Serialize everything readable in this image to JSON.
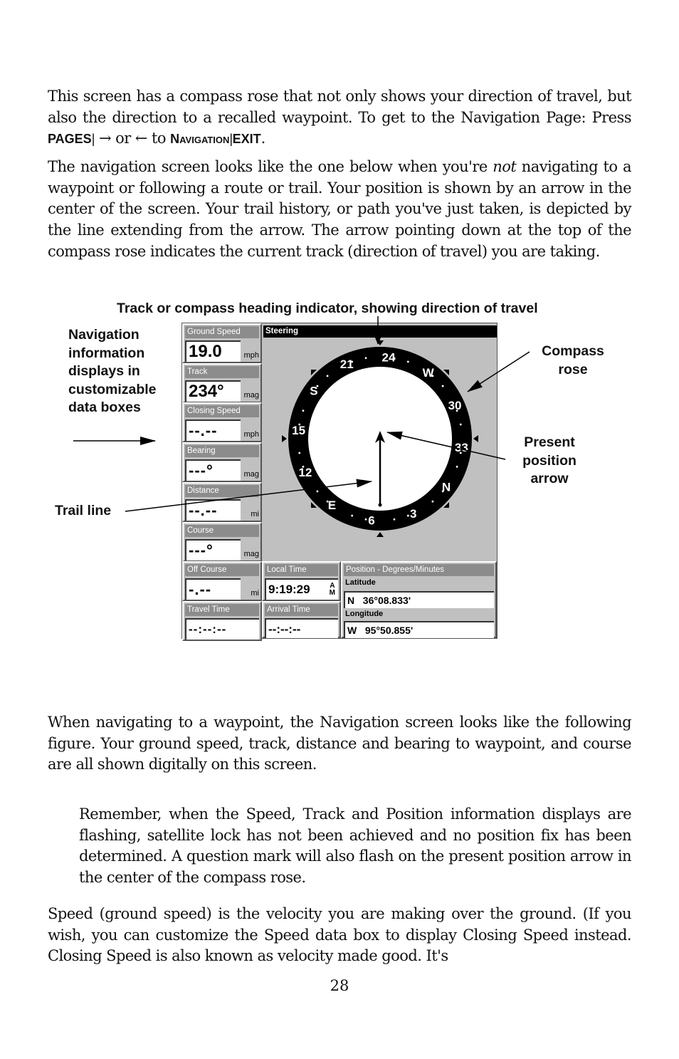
{
  "paragraphs": {
    "intro": {
      "text_before": "This screen has a compass rose that not only shows your direction of travel, but also the direction to a recalled waypoint. To get to the Navigation Page: Press ",
      "key_pages": "PAGES",
      "sep1": "|",
      "arrows_text": " → or ← to ",
      "key_navigation_initial": "N",
      "key_navigation_rest": "AVIGATION",
      "sep2": "|",
      "key_exit": "EXIT",
      "text_after": "."
    },
    "not_navigating": {
      "text_before": "The navigation screen looks like the one below when you're ",
      "emphasis": "not",
      "text_after": " navigating to a waypoint or following a route or trail. Your position is shown by an arrow in the center of the screen. Your trail history, or path you've just taken, is depicted by the line extending from the arrow. The arrow pointing down at the top of the compass rose indicates the current track (direction of travel) you are taking."
    },
    "navigating": "When navigating to a waypoint, the Navigation screen looks like the following figure. Your ground speed, track, distance and bearing to waypoint, and course are all shown digitally on this screen.",
    "note": "Remember, when the Speed, Track and Position information displays are flashing, satellite lock has not been achieved and no position fix has been determined. A question mark will also flash on the present position arrow in the center of the compass rose.",
    "speed": "Speed (ground speed) is the velocity you are making over the ground. (If you wish, you can customize the Speed data box to display Closing Speed instead. Closing Speed is also known as velocity made good. It's"
  },
  "page_number": "28",
  "figure": {
    "callouts": {
      "track_indicator": "Track or compass heading indicator, showing direction of travel",
      "nav_info": [
        "Navigation",
        "information",
        "displays in",
        "customizable",
        "data boxes"
      ],
      "compass_rose": [
        "Compass",
        "rose"
      ],
      "present_position": [
        "Present",
        "position",
        "arrow"
      ],
      "trail_line": "Trail line"
    },
    "screen": {
      "data_boxes": [
        {
          "label": "Ground Speed",
          "value": "19.0",
          "unit": "mph"
        },
        {
          "label": "Track",
          "value": "234°",
          "unit": "mag"
        },
        {
          "label": "Closing Speed",
          "value": "--.--",
          "unit": "mph"
        },
        {
          "label": "Bearing",
          "value": "---°",
          "unit": "mag"
        },
        {
          "label": "Distance",
          "value": "--.--",
          "unit": "mi"
        },
        {
          "label": "Course",
          "value": "---°",
          "unit": "mag"
        },
        {
          "label": "Off Course",
          "value": "-.--",
          "unit": "mi"
        },
        {
          "label": "Travel Time",
          "value": "--:--:--",
          "unit": ""
        }
      ],
      "local_time": {
        "label": "Local Time",
        "value": "9:19:29",
        "ampm_top": "A",
        "ampm_bottom": "M"
      },
      "arrival_time": {
        "label": "Arrival Time",
        "value": "--:--:--"
      },
      "position": {
        "label": "Position - Degrees/Minutes",
        "latitude_label": "Latitude",
        "latitude_value": "N   36°08.833'",
        "longitude_label": "Longitude",
        "longitude_value": "W   95°50.855'"
      },
      "steering": {
        "title": "Steering",
        "compass_labels": [
          "24",
          "W",
          "30",
          "33",
          "N",
          "3",
          "6",
          "E",
          "12",
          "15",
          "S",
          "21"
        ],
        "track_heading_deg": 234
      }
    }
  }
}
